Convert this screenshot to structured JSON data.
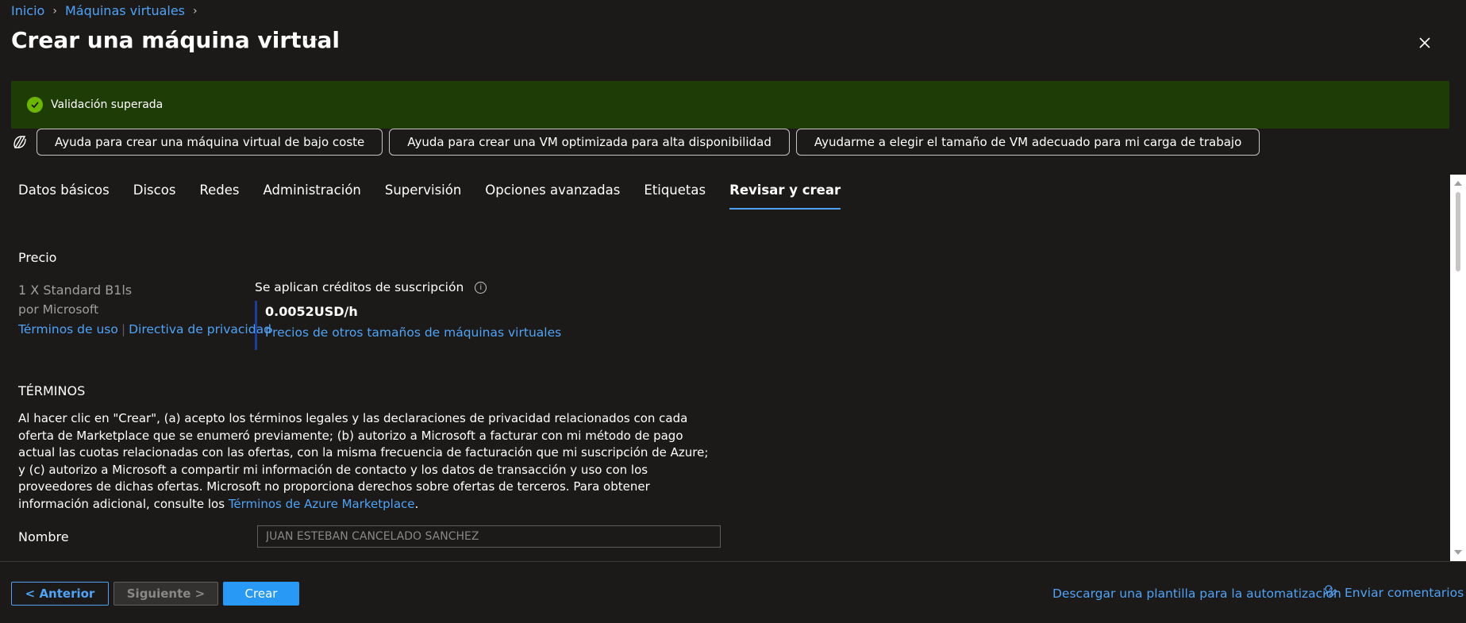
{
  "breadcrumb": {
    "items": [
      "Inicio",
      "Máquinas virtuales"
    ]
  },
  "header": {
    "title": "Crear una máquina virtual",
    "more": "···"
  },
  "banner": {
    "text": "Validación superada",
    "color": "#1e3c06"
  },
  "help_buttons": [
    "Ayuda para crear una máquina virtual de bajo coste",
    "Ayuda para crear una VM optimizada para alta disponibilidad",
    "Ayudarme a elegir el tamaño de VM adecuado para mi carga de trabajo"
  ],
  "tabs": [
    {
      "label": "Datos básicos",
      "active": false
    },
    {
      "label": "Discos",
      "active": false
    },
    {
      "label": "Redes",
      "active": false
    },
    {
      "label": "Administración",
      "active": false
    },
    {
      "label": "Supervisión",
      "active": false
    },
    {
      "label": "Opciones avanzadas",
      "active": false
    },
    {
      "label": "Etiquetas",
      "active": false
    },
    {
      "label": "Revisar y crear",
      "active": true
    }
  ],
  "price": {
    "section_title": "Precio",
    "sku": "1 X Standard B1ls",
    "publisher": "por Microsoft",
    "terms_link": "Términos de uso",
    "privacy_link": "Directiva de privacidad",
    "credits_label": "Se aplican créditos de suscripción",
    "value": "0.0052USD/h",
    "other_sizes_link": "Precios de otros tamaños de máquinas virtuales"
  },
  "terms": {
    "section_title": "TÉRMINOS",
    "body": "Al hacer clic en \"Crear\", (a) acepto los términos legales y las declaraciones de privacidad relacionados con cada oferta de Marketplace que se enumeró previamente; (b) autorizo a Microsoft a facturar con mi método de pago actual las cuotas relacionadas con las ofertas, con la misma frecuencia de facturación que mi suscripción de Azure; y (c) autorizo a Microsoft a compartir mi información de contacto y los datos de transacción y uso con los proveedores de dichas ofertas. Microsoft no proporciona derechos sobre ofertas de terceros. Para obtener información adicional, consulte los ",
    "link": "Términos de Azure Marketplace",
    "end": "."
  },
  "name_field": {
    "label": "Nombre",
    "value": "JUAN ESTEBAN CANCELADO SANCHEZ"
  },
  "footer": {
    "prev": "< Anterior",
    "next": "Siguiente >",
    "create": "Crear",
    "download_template": "Descargar una plantilla para la automatización",
    "feedback": "Enviar comentarios"
  },
  "colors": {
    "accent": "#4fa3f7",
    "primary_button": "#2899f5",
    "background": "#1b1a19",
    "success": "#6bb700"
  }
}
